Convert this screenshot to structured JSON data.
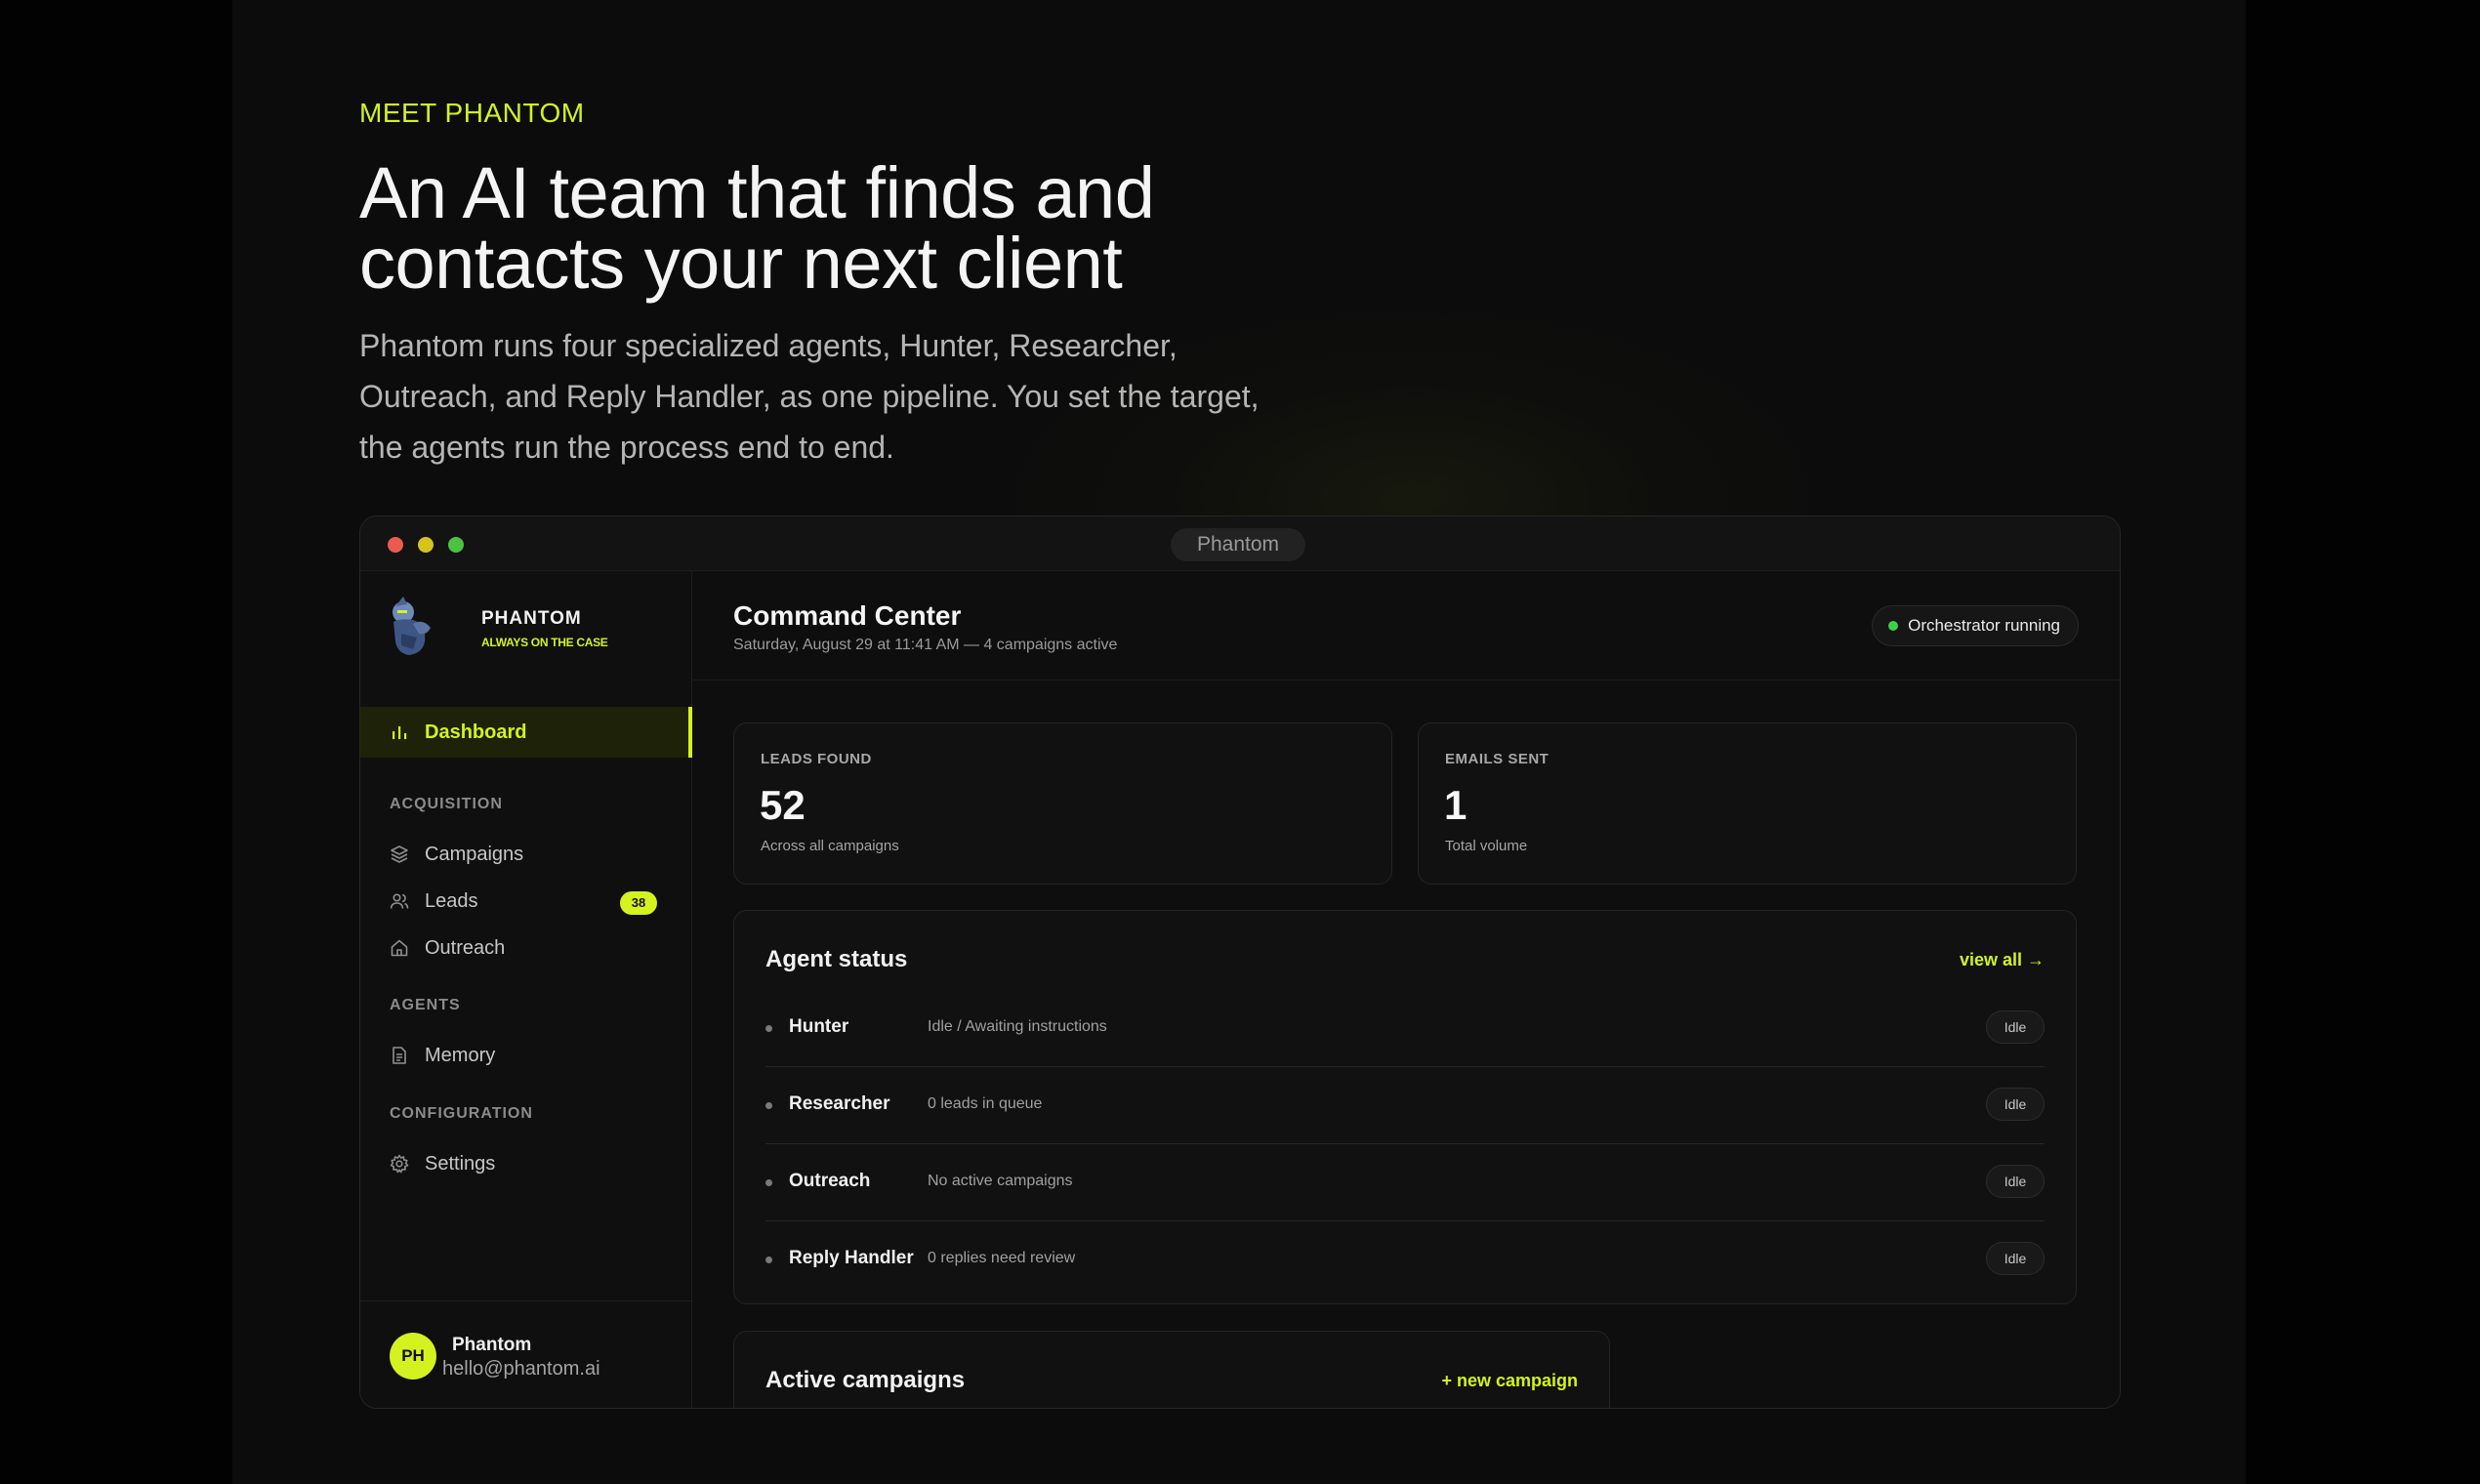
{
  "hero": {
    "eyebrow": "MEET PHANTOM",
    "headline": "An AI team that finds and contacts your next client",
    "subtext": "Phantom runs four specialized agents, Hunter, Researcher, Outreach, and Reply Handler, as one pipeline. You set the target, the agents run the process end to end."
  },
  "window": {
    "title": "Phantom"
  },
  "sidebar": {
    "brand_name": "PHANTOM",
    "brand_tag": "ALWAYS ON THE CASE",
    "active_item": "Dashboard",
    "sections": [
      {
        "heading": "ACQUISITION",
        "items": [
          {
            "label": "Campaigns",
            "icon": "layers-icon"
          },
          {
            "label": "Leads",
            "icon": "users-icon",
            "badge": "38"
          },
          {
            "label": "Outreach",
            "icon": "home-icon"
          }
        ]
      },
      {
        "heading": "AGENTS",
        "items": [
          {
            "label": "Memory",
            "icon": "document-icon"
          }
        ]
      },
      {
        "heading": "CONFIGURATION",
        "items": [
          {
            "label": "Settings",
            "icon": "gear-icon"
          }
        ]
      }
    ],
    "user": {
      "initials": "PH",
      "name": "Phantom",
      "email": "hello@phantom.ai"
    }
  },
  "main": {
    "title": "Command Center",
    "subtitle": "Saturday, August 29 at 11:41 AM — 4 campaigns active",
    "status": "Orchestrator running",
    "stats": [
      {
        "label": "LEADS FOUND",
        "value": "52",
        "note": "Across all campaigns"
      },
      {
        "label": "EMAILS SENT",
        "value": "1",
        "note": "Total volume"
      }
    ],
    "agents": {
      "title": "Agent status",
      "link": "view all →",
      "rows": [
        {
          "name": "Hunter",
          "desc": "Idle / Awaiting instructions",
          "state": "Idle"
        },
        {
          "name": "Researcher",
          "desc": "0 leads in queue",
          "state": "Idle"
        },
        {
          "name": "Outreach",
          "desc": "No active campaigns",
          "state": "Idle"
        },
        {
          "name": "Reply Handler",
          "desc": "0 replies need review",
          "state": "Idle"
        }
      ]
    },
    "campaigns": {
      "title": "Active campaigns",
      "link": "+ new campaign"
    }
  },
  "colors": {
    "accent": "#d4f21f",
    "background": "#0c0c0c",
    "running": "#3fce4a"
  }
}
